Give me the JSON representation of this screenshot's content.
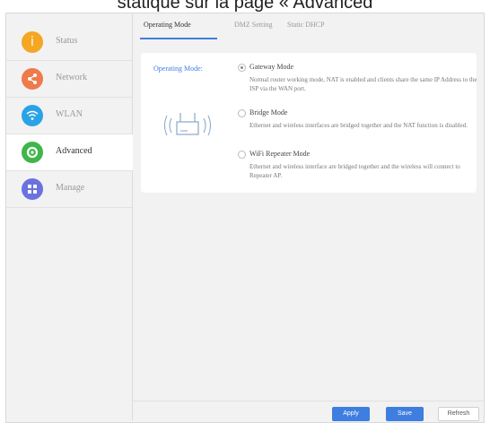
{
  "caption": "statique sur la page « Advanced",
  "colors": {
    "accent": "#3e7ee0",
    "status": "#f5a623",
    "network": "#ef7a4a",
    "wlan": "#2aa3e6",
    "advanced": "#3fb64b",
    "manage": "#6a72e0"
  },
  "sidebar": {
    "items": [
      {
        "label": "Status",
        "icon": "info-icon"
      },
      {
        "label": "Network",
        "icon": "share-icon"
      },
      {
        "label": "WLAN",
        "icon": "wifi-icon"
      },
      {
        "label": "Advanced",
        "icon": "gear-icon"
      },
      {
        "label": "Manage",
        "icon": "apps-icon"
      }
    ]
  },
  "tabs": [
    {
      "label": "Operating Mode"
    },
    {
      "label": "DMZ Setting"
    },
    {
      "label": "Static DHCP"
    }
  ],
  "operating_mode": {
    "label": "Operating Mode:",
    "options": [
      {
        "title": "Gateway Mode",
        "desc": "Normal router working mode, NAT is enabled and clients share the same IP Address to the ISP via the WAN port."
      },
      {
        "title": "Bridge Mode",
        "desc": "Ethernet and wireless interfaces are bridged together and the NAT function is disabled."
      },
      {
        "title": "WiFi Repeater Mode",
        "desc": "Ethernet and wireless interface are bridged together and the wireless will connect to Repeater AP."
      }
    ],
    "selected": "Gateway Mode"
  },
  "footer": {
    "apply": "Apply",
    "save": "Save",
    "refresh": "Refresh"
  }
}
